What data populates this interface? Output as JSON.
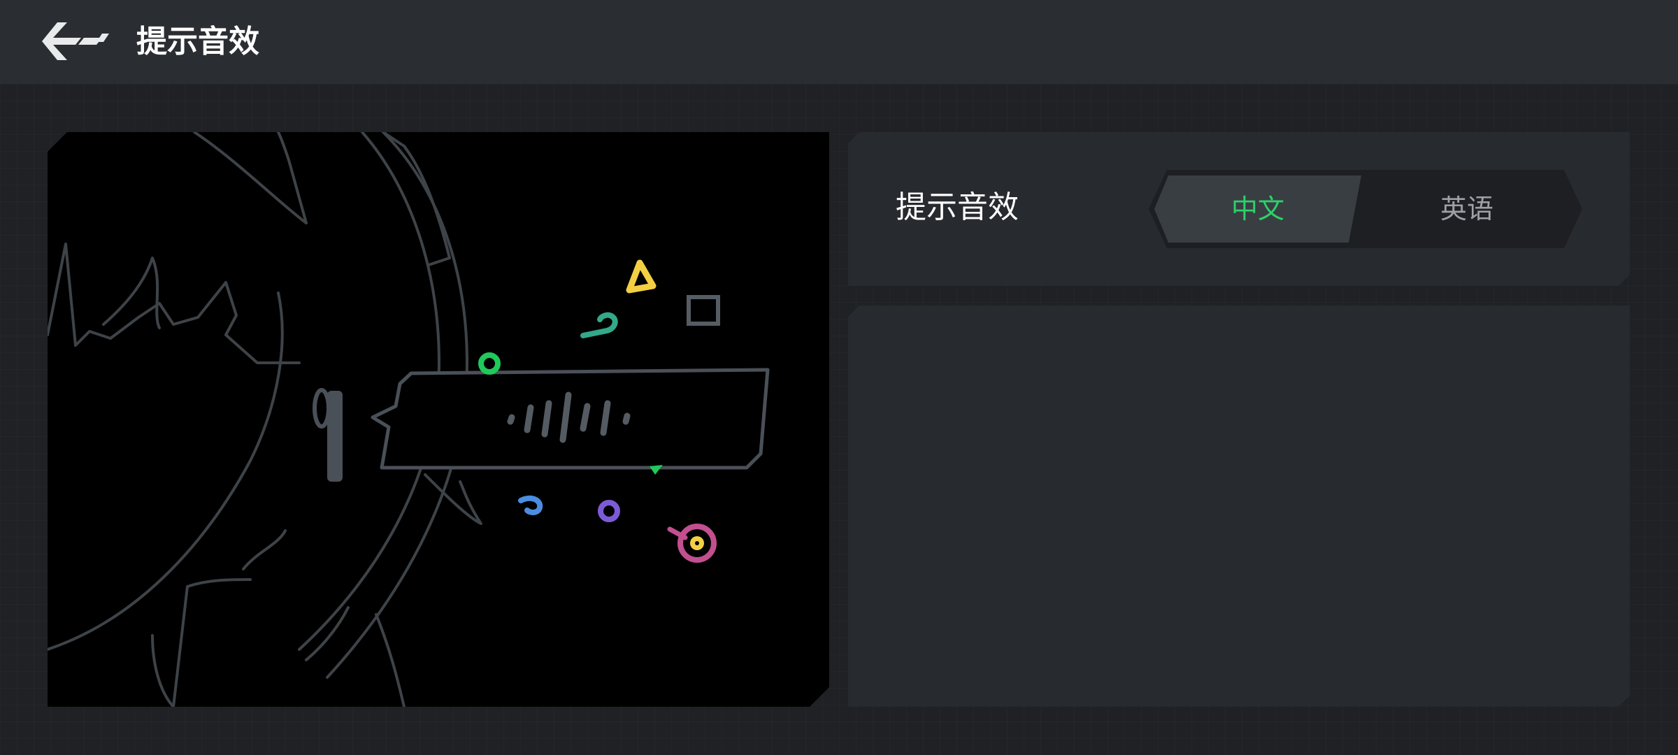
{
  "header": {
    "title": "提示音效",
    "back_icon": "back-arrow-icon"
  },
  "setting": {
    "label": "提示音效",
    "options": [
      {
        "label": "中文",
        "selected": true
      },
      {
        "label": "英语",
        "selected": false
      }
    ]
  },
  "colors": {
    "accent": "#2ed06a",
    "background": "#1f2124",
    "topbar": "#2a2d31",
    "card": "#272a2e"
  }
}
